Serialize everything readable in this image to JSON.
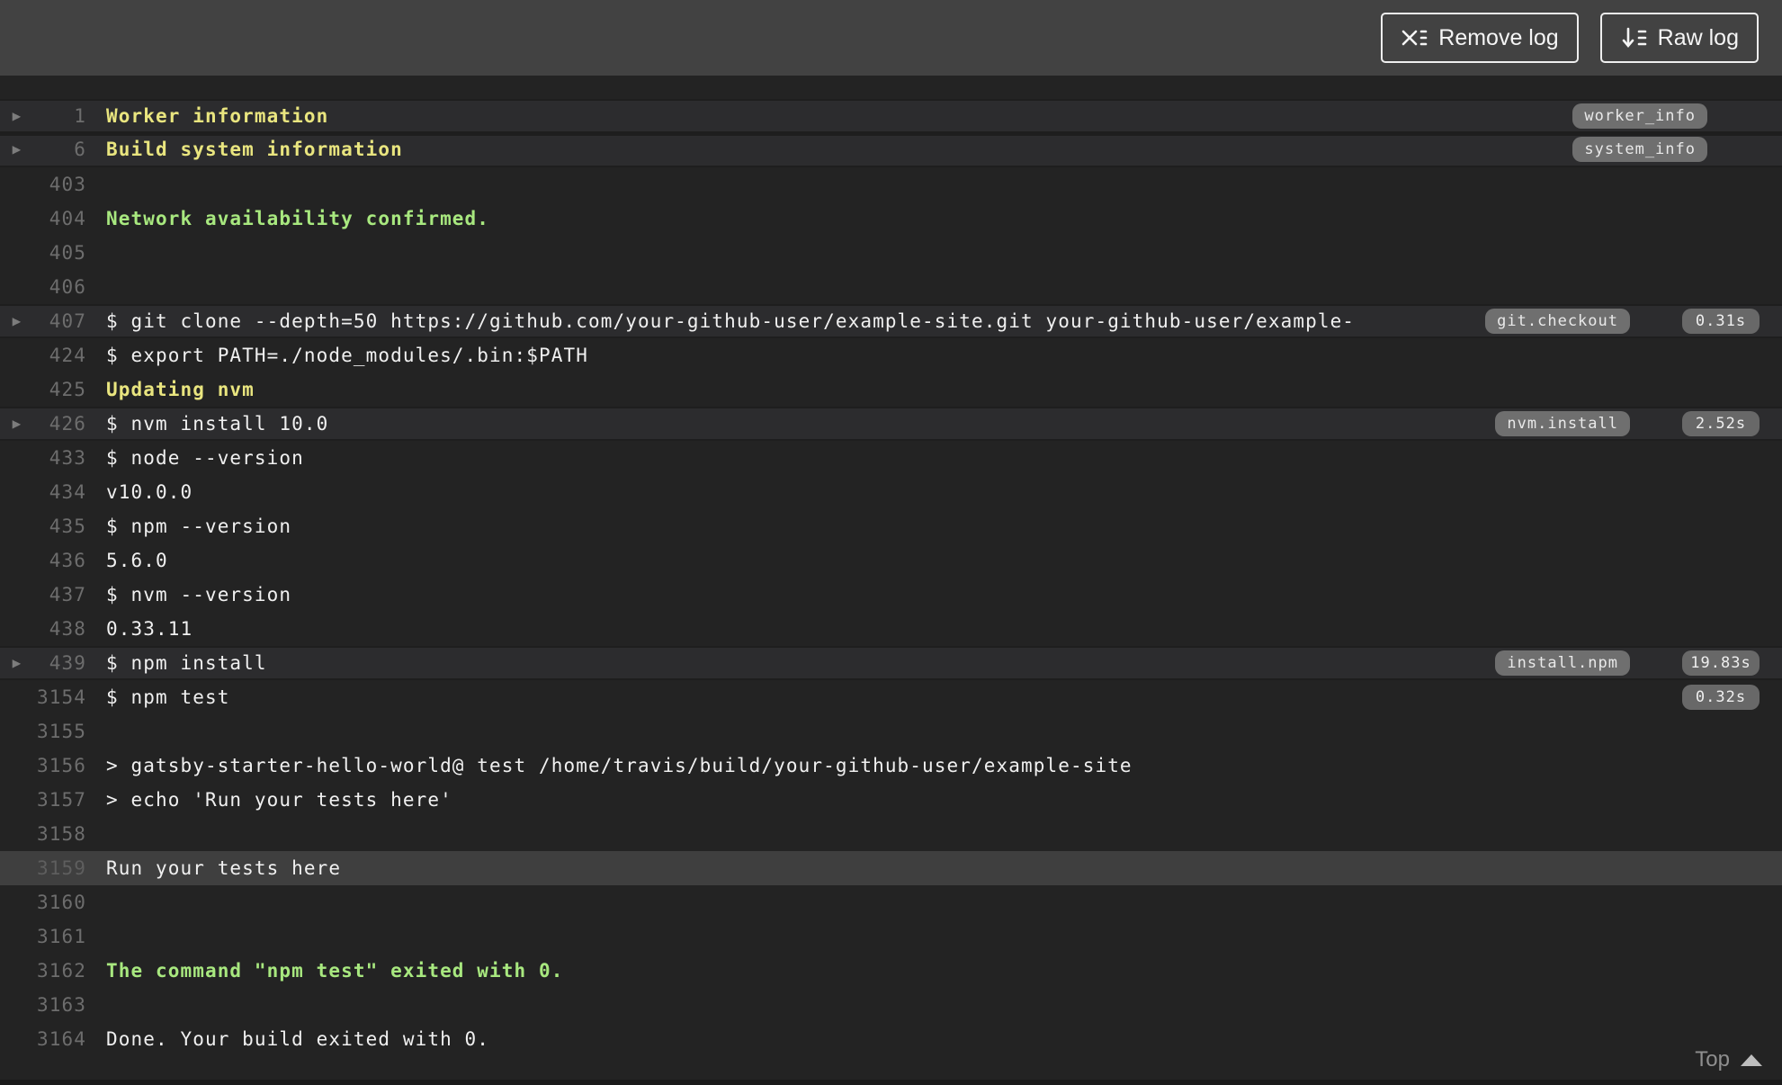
{
  "header": {
    "remove_log_label": "Remove log",
    "raw_log_label": "Raw log"
  },
  "footer": {
    "top_label": "Top"
  },
  "colors": {
    "header_bg": "#424242",
    "log_bg": "#232323",
    "fold_row_bg": "#2c2c2e",
    "highlight_row_bg": "#3f3f3f",
    "fold_title_yellow": "#e9e57f",
    "success_green": "#a8e87f",
    "log_text": "#f0f0f0",
    "line_number": "#6d6d6d",
    "badge_bg": "#6f6f6f"
  },
  "log": {
    "rows": [
      {
        "num": "1",
        "text": "Worker information",
        "style": "yellow",
        "fold": true,
        "arrow": true,
        "badge": "worker_info"
      },
      {
        "num": "6",
        "text": "Build system information",
        "style": "yellow",
        "fold": true,
        "arrow": true,
        "badge": "system_info"
      },
      {
        "num": "403",
        "text": ""
      },
      {
        "num": "404",
        "text": "Network availability confirmed.",
        "style": "green"
      },
      {
        "num": "405",
        "text": ""
      },
      {
        "num": "406",
        "text": ""
      },
      {
        "num": "407",
        "text": "$ git clone --depth=50 https://github.com/your-github-user/example-site.git your-github-user/example-",
        "fold": true,
        "arrow": true,
        "badge": "git.checkout",
        "duration": "0.31s"
      },
      {
        "num": "424",
        "text": "$ export PATH=./node_modules/.bin:$PATH"
      },
      {
        "num": "425",
        "text": "Updating nvm",
        "style": "yellow"
      },
      {
        "num": "426",
        "text": "$ nvm install 10.0",
        "fold": true,
        "arrow": true,
        "badge": "nvm.install",
        "duration": "2.52s"
      },
      {
        "num": "433",
        "text": "$ node --version"
      },
      {
        "num": "434",
        "text": "v10.0.0"
      },
      {
        "num": "435",
        "text": "$ npm --version"
      },
      {
        "num": "436",
        "text": "5.6.0"
      },
      {
        "num": "437",
        "text": "$ nvm --version"
      },
      {
        "num": "438",
        "text": "0.33.11"
      },
      {
        "num": "439",
        "text": "$ npm install",
        "fold": true,
        "arrow": true,
        "badge": "install.npm",
        "duration": "19.83s"
      },
      {
        "num": "3154",
        "text": "$ npm test",
        "duration": "0.32s"
      },
      {
        "num": "3155",
        "text": ""
      },
      {
        "num": "3156",
        "text": "> gatsby-starter-hello-world@ test /home/travis/build/your-github-user/example-site"
      },
      {
        "num": "3157",
        "text": "> echo 'Run your tests here'"
      },
      {
        "num": "3158",
        "text": ""
      },
      {
        "num": "3159",
        "text": "Run your tests here",
        "highlight": true
      },
      {
        "num": "3160",
        "text": ""
      },
      {
        "num": "3161",
        "text": ""
      },
      {
        "num": "3162",
        "text": "The command \"npm test\" exited with 0.",
        "style": "green"
      },
      {
        "num": "3163",
        "text": ""
      },
      {
        "num": "3164",
        "text": "Done. Your build exited with 0."
      }
    ]
  }
}
